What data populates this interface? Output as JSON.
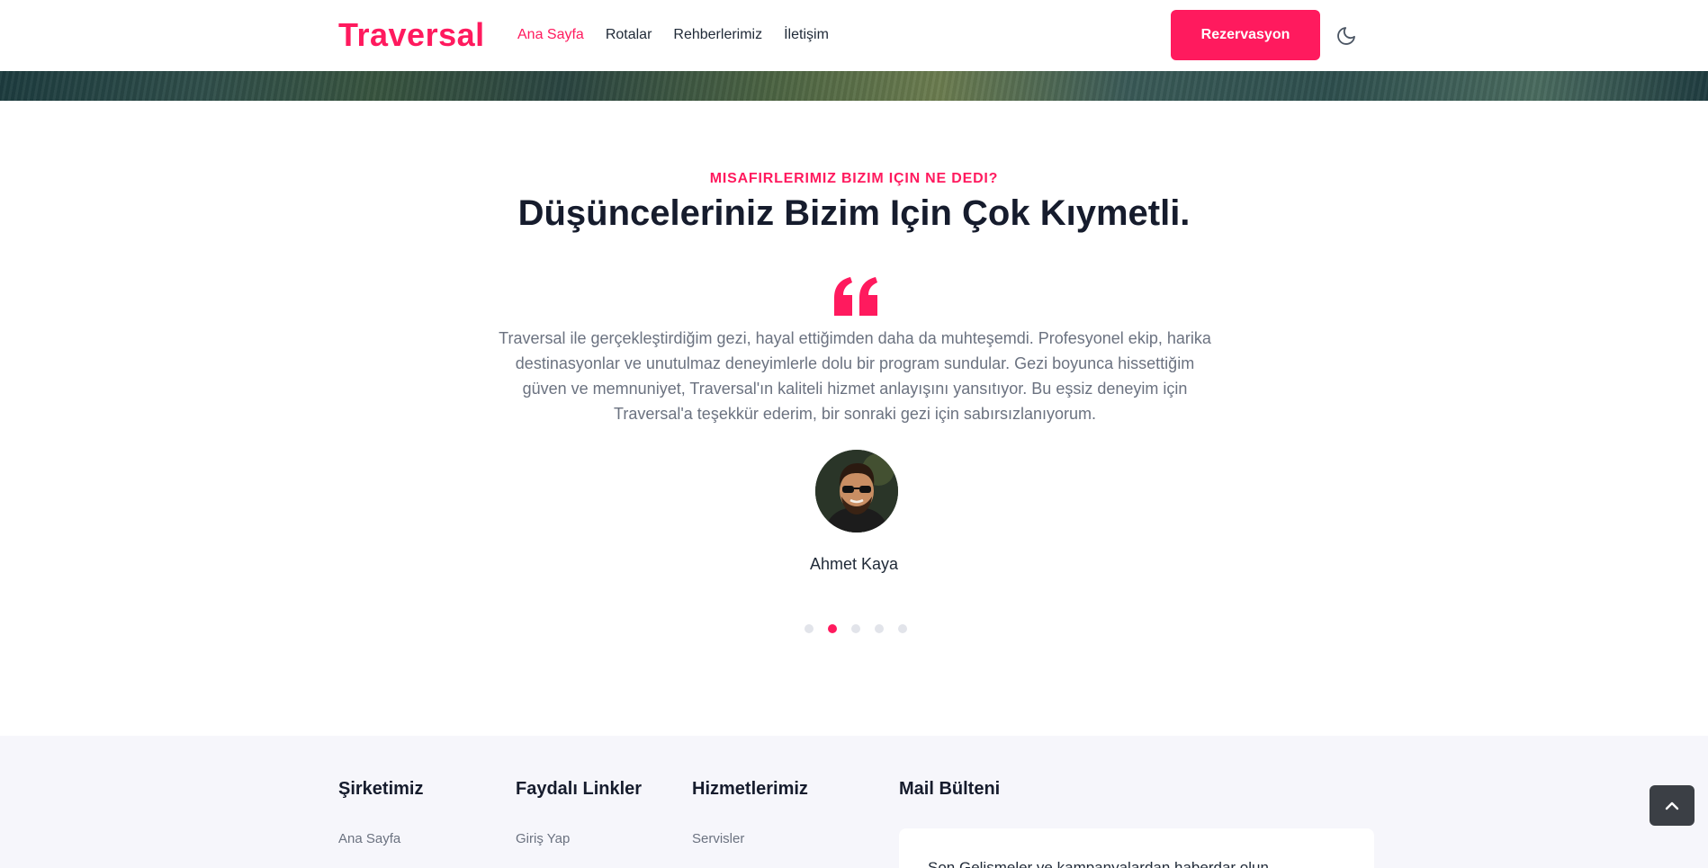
{
  "header": {
    "logo": "Traversal",
    "nav": [
      "Ana Sayfa",
      "Rotalar",
      "Rehberlerimiz",
      "İletişim"
    ],
    "reserve_label": "Rezervasyon"
  },
  "testimonials": {
    "eyebrow": "MISAFIRLERIMIZ BIZIM IÇIN NE DEDI?",
    "title": "Düşünceleriniz Bizim Için Çok Kıymetli.",
    "quote": "Traversal ile gerçekleştirdiğim gezi, hayal ettiğimden daha da muhteşemdi. Profesyonel ekip, harika destinasyonlar ve unutulmaz deneyimlerle dolu bir program sundular. Gezi boyunca hissettiğim güven ve memnuniyet, Traversal'ın kaliteli hizmet anlayışını yansıtıyor. Bu eşsiz deneyim için Traversal'a teşekkür ederim, bir sonraki gezi için sabırsızlanıyorum.",
    "author": "Ahmet Kaya",
    "slide_count": 5,
    "active_slide": 2
  },
  "footer": {
    "company_title": "Şirketimiz",
    "company_link": "Ana Sayfa",
    "links_title": "Faydalı Linkler",
    "links_link": "Giriş Yap",
    "services_title": "Hizmetlerimiz",
    "services_link": "Servisler",
    "newsletter_title": "Mail Bülteni",
    "newsletter_text": "Son Gelişmeler ve kampanyalardan haberdar olun"
  },
  "colors": {
    "accent": "#ff1a5e",
    "heading": "#161c2d",
    "footer_bg": "#f6f6fb",
    "back_to_top": "#3b3f45"
  },
  "icons": {
    "theme_toggle": "moon-icon",
    "quote": "quote-icon",
    "back_to_top": "chevron-up-icon"
  }
}
